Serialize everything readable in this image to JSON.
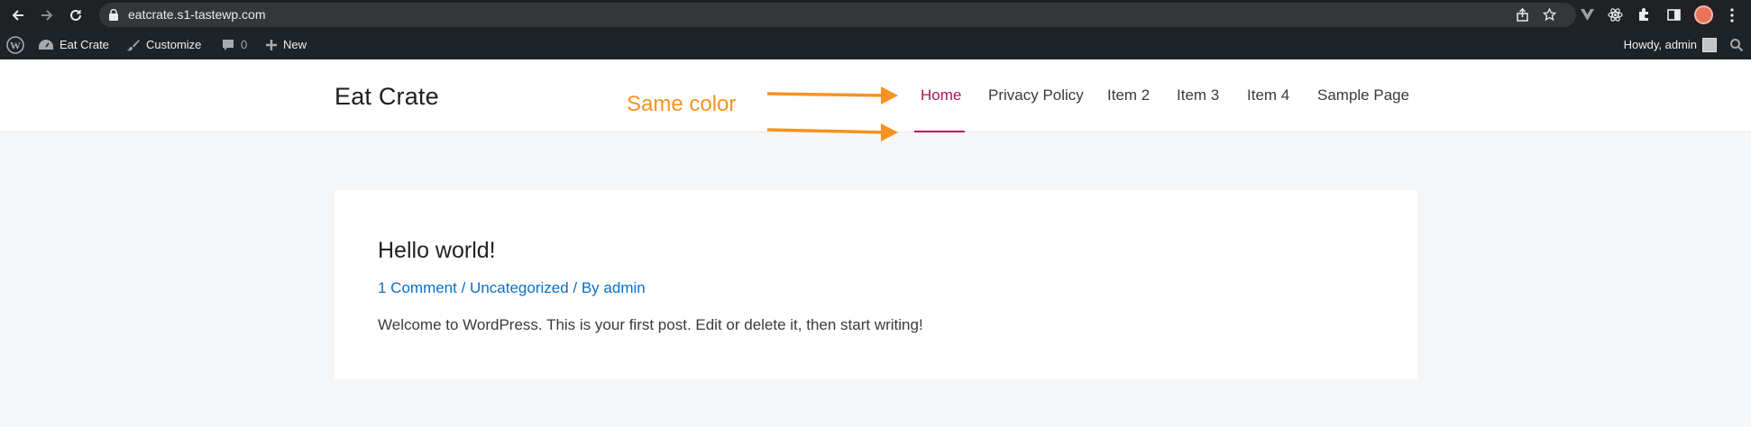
{
  "browser": {
    "url": "eatcrate.s1-tastewp.com"
  },
  "adminbar": {
    "site_name": "Eat Crate",
    "customize": "Customize",
    "comments_count": "0",
    "new": "New",
    "howdy": "Howdy, admin"
  },
  "header": {
    "site_title": "Eat Crate",
    "annotation": "Same color",
    "annotation_color": "#f7931e",
    "active_color": "#b1125a",
    "menu": [
      {
        "label": "Home"
      },
      {
        "label": "Privacy Policy"
      },
      {
        "label": "Item 2"
      },
      {
        "label": "Item 3"
      },
      {
        "label": "Item 4"
      },
      {
        "label": "Sample Page"
      }
    ]
  },
  "post": {
    "title": "Hello world!",
    "comments_link": "1 Comment",
    "separator": " / ",
    "category": "Uncategorized",
    "by": " / By ",
    "author": "admin",
    "excerpt": "Welcome to WordPress. This is your first post. Edit or delete it, then start writing!"
  }
}
